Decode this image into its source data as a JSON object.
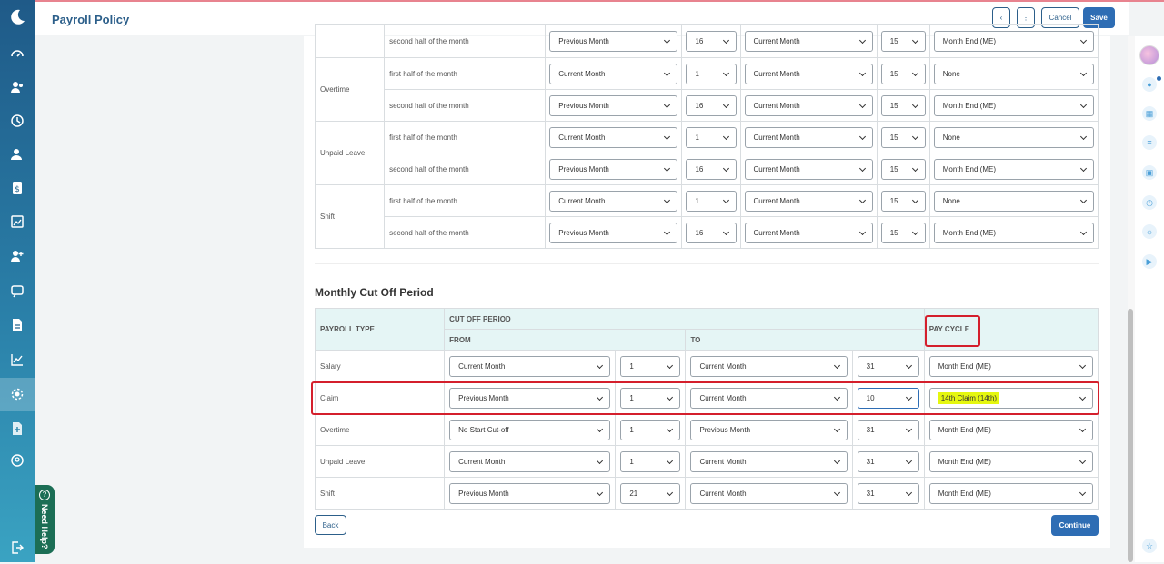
{
  "header": {
    "title": "Payroll Policy",
    "cancel_label": "Cancel",
    "save_label": "Save"
  },
  "help": {
    "label": "Need Help?"
  },
  "sidebar": {
    "items": [
      "dashboard-icon",
      "employees-icon",
      "attendance-icon",
      "leave-icon",
      "payroll-icon",
      "reports-icon",
      "recruitment-icon",
      "messages-icon",
      "documents-icon",
      "analytics-icon",
      "settings-icon",
      "add-document-icon",
      "account-icon"
    ],
    "logout": "logout-icon"
  },
  "top_table": {
    "rows": [
      {
        "type": "",
        "half": "second half of the month",
        "from_month": "Previous Month",
        "from_day": "16",
        "to_month": "Current Month",
        "to_day": "15",
        "pay_cycle": "Month End (ME)"
      },
      {
        "type": "Overtime",
        "half": "first half of the month",
        "from_month": "Current Month",
        "from_day": "1",
        "to_month": "Current Month",
        "to_day": "15",
        "pay_cycle": "None"
      },
      {
        "type": "",
        "half": "second half of the month",
        "from_month": "Previous Month",
        "from_day": "16",
        "to_month": "Current Month",
        "to_day": "15",
        "pay_cycle": "Month End (ME)"
      },
      {
        "type": "Unpaid Leave",
        "half": "first half of the month",
        "from_month": "Current Month",
        "from_day": "1",
        "to_month": "Current Month",
        "to_day": "15",
        "pay_cycle": "None"
      },
      {
        "type": "",
        "half": "second half of the month",
        "from_month": "Previous Month",
        "from_day": "16",
        "to_month": "Current Month",
        "to_day": "15",
        "pay_cycle": "Month End (ME)"
      },
      {
        "type": "Shift",
        "half": "first half of the month",
        "from_month": "Current Month",
        "from_day": "1",
        "to_month": "Current Month",
        "to_day": "15",
        "pay_cycle": "None"
      },
      {
        "type": "",
        "half": "second half of the month",
        "from_month": "Previous Month",
        "from_day": "16",
        "to_month": "Current Month",
        "to_day": "15",
        "pay_cycle": "Month End (ME)"
      }
    ]
  },
  "monthly": {
    "title": "Monthly Cut Off Period",
    "headers": {
      "payroll_type": "PAYROLL TYPE",
      "cut_off": "CUT OFF PERIOD",
      "pay_cycle": "PAY CYCLE",
      "from": "FROM",
      "to": "TO"
    },
    "rows": [
      {
        "type": "Salary",
        "from_month": "Current Month",
        "from_day": "1",
        "to_month": "Current Month",
        "to_day": "31",
        "pay_cycle": "Month End (ME)"
      },
      {
        "type": "Claim",
        "from_month": "Previous Month",
        "from_day": "1",
        "to_month": "Current Month",
        "to_day": "10",
        "pay_cycle": "14th Claim (14th)"
      },
      {
        "type": "Overtime",
        "from_month": "No Start Cut-off",
        "from_day": "1",
        "to_month": "Previous Month",
        "to_day": "31",
        "pay_cycle": "Month End (ME)"
      },
      {
        "type": "Unpaid Leave",
        "from_month": "Current Month",
        "from_day": "1",
        "to_month": "Current Month",
        "to_day": "31",
        "pay_cycle": "Month End (ME)"
      },
      {
        "type": "Shift",
        "from_month": "Previous Month",
        "from_day": "21",
        "to_month": "Current Month",
        "to_day": "31",
        "pay_cycle": "Month End (ME)"
      }
    ]
  },
  "footer": {
    "back_label": "Back",
    "continue_label": "Continue"
  },
  "colors": {
    "accent": "#2e6db4",
    "highlight": "#e5f70f",
    "annotation": "#d41f2c"
  }
}
